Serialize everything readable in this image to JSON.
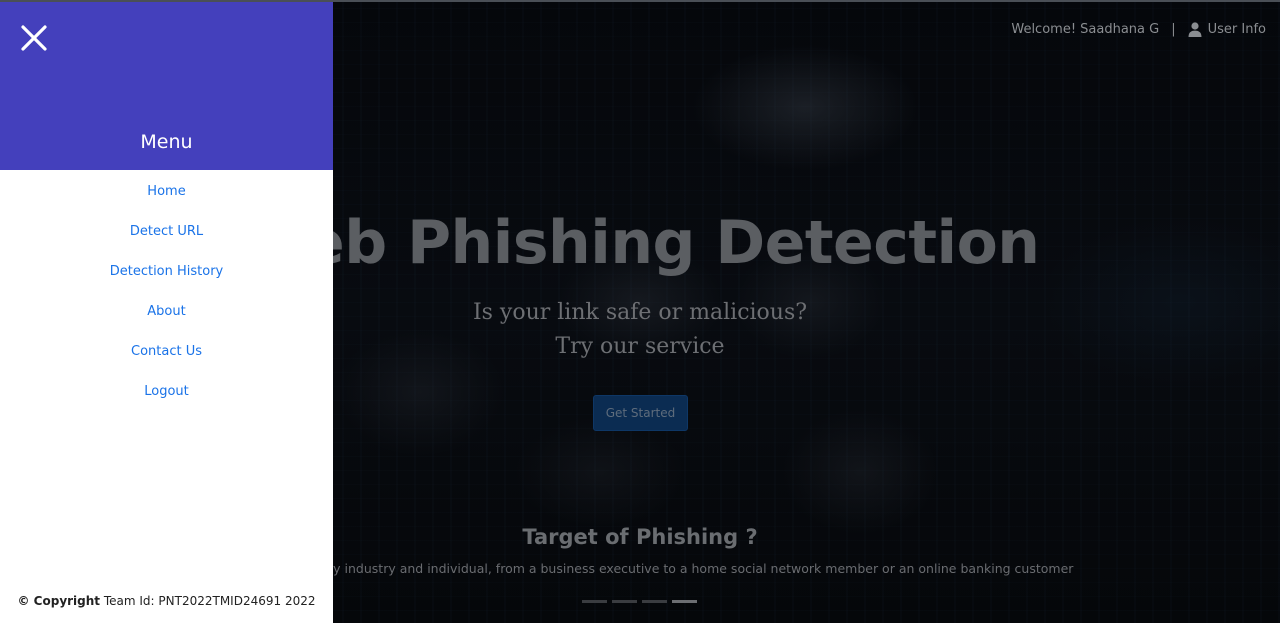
{
  "topbar": {
    "welcome": "Welcome! Saadhana G",
    "separator": "|",
    "user_info": "User Info",
    "user_icon": "user-icon"
  },
  "hero": {
    "title": "Web Phishing Detection",
    "subtitle_line1": "Is your link safe or malicious?",
    "subtitle_line2": "Try our service",
    "cta_label": "Get Started"
  },
  "section": {
    "title": "Target of Phishing ?",
    "text": "Phishers target every industry and individual, from a business executive to a home social network member or an online banking customer"
  },
  "carousel": {
    "slide_count": 4,
    "active_index": 3
  },
  "sidebar": {
    "close_icon": "close-icon",
    "menu_title": "Menu",
    "items": [
      {
        "label": "Home"
      },
      {
        "label": "Detect URL"
      },
      {
        "label": "Detection History"
      },
      {
        "label": "About"
      },
      {
        "label": "Contact Us"
      },
      {
        "label": "Logout"
      }
    ],
    "copyright_strong": "© Copyright",
    "copyright_text": " Team Id: PNT2022TMID24691 2022"
  },
  "colors": {
    "sidebar_header": "#4440bc",
    "link": "#1a73e8",
    "cta_bg": "#0b2c52"
  }
}
